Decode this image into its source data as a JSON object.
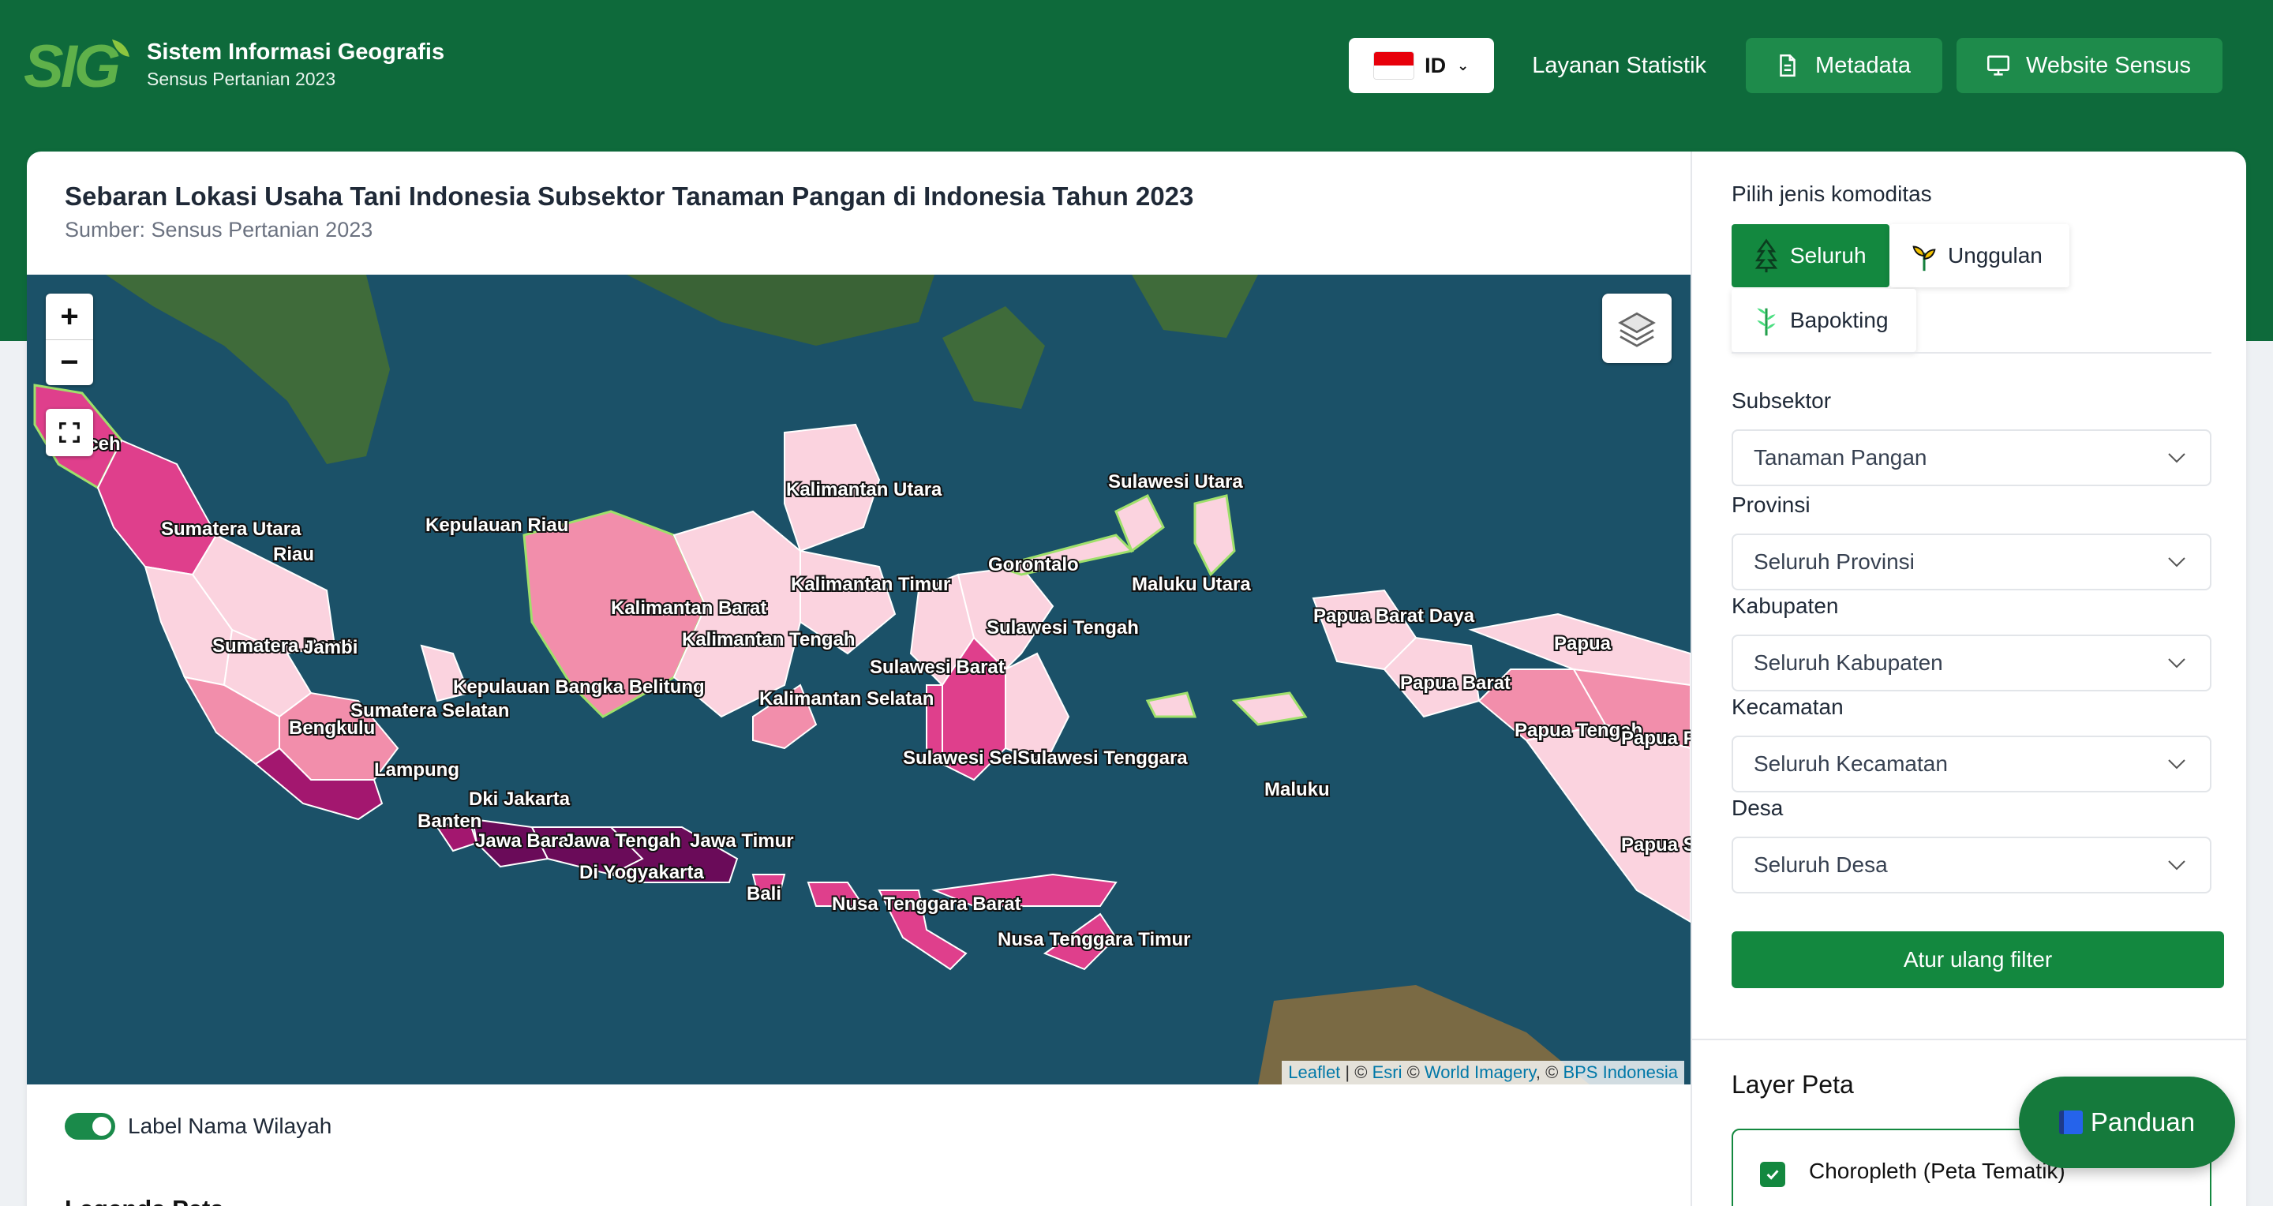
{
  "header": {
    "app_title": "Sistem Informasi Geografis",
    "app_subtitle": "Sensus Pertanian 2023",
    "lang": "ID",
    "nav_link": "Layanan Statistik",
    "btn_metadata": "Metadata",
    "btn_website": "Website Sensus"
  },
  "main": {
    "title": "Sebaran Lokasi Usaha Tani Indonesia Subsektor Tanaman Pangan di Indonesia Tahun 2023",
    "source": "Sumber: Sensus Pertanian 2023"
  },
  "map": {
    "zoom_in": "+",
    "zoom_out": "−",
    "attribution": {
      "leaflet": "Leaflet",
      "sep1": " | © ",
      "esri": "Esri",
      "sep2": " © ",
      "imagery": "World Imagery",
      "sep3": ", © ",
      "bps": "BPS Indonesia"
    },
    "labels": {
      "aceh": "Aceh",
      "sumut": "Sumatera Utara",
      "riau": "Riau",
      "kepri": "Kepulauan Riau",
      "sumbar": "Sumatera Barat",
      "jambi": "Jambi",
      "sumsel": "Sumatera Selatan",
      "babel": "Kepulauan Bangka Belitung",
      "bengkulu": "Bengkulu",
      "lampung": "Lampung",
      "dki": "Dki Jakarta",
      "banten": "Banten",
      "jabar": "Jawa Barat",
      "jateng": "Jawa Tengah",
      "diy": "Di Yogyakarta",
      "jatim": "Jawa Timur",
      "bali": "Bali",
      "ntb": "Nusa Tenggara Barat",
      "ntt": "Nusa Tenggara Timur",
      "kalbar": "Kalimantan Barat",
      "kalteng": "Kalimantan Tengah",
      "kalsel": "Kalimantan Selatan",
      "kaltim": "Kalimantan Timur",
      "kaltara": "Kalimantan Utara",
      "sulbar": "Sulawesi Barat",
      "sulsel": "Sulawesi Selatan",
      "sulteng": "Sulawesi Tengah",
      "sultra": "Sulawesi Tenggara",
      "gorontalo": "Gorontalo",
      "sulut": "Sulawesi Utara",
      "malut": "Maluku Utara",
      "maluku": "Maluku",
      "pbd": "Papua Barat Daya",
      "pb": "Papua Barat",
      "papua": "Papua",
      "pt": "Papua Tengah",
      "pp": "Papua Pegunungan",
      "ps": "Papua Selatan"
    },
    "colors": {
      "sea": "#1b5168",
      "land": "#3f6b3a",
      "lightest": "#fbd3df",
      "light": "#f28eab",
      "mid": "#df3f8c",
      "dark": "#a3176f",
      "darkest": "#6a0b59"
    }
  },
  "footer_left": {
    "toggle_label": "Label Nama Wilayah",
    "legend_title": "Legenda Peta"
  },
  "panel": {
    "commodity_label": "Pilih jenis komoditas",
    "seg_all": "Seluruh",
    "seg_unggulan": "Unggulan",
    "seg_bapokting": "Bapokting",
    "subsektor_label": "Subsektor",
    "subsektor_value": "Tanaman Pangan",
    "provinsi_label": "Provinsi",
    "provinsi_value": "Seluruh Provinsi",
    "kabupaten_label": "Kabupaten",
    "kabupaten_value": "Seluruh Kabupaten",
    "kecamatan_label": "Kecamatan",
    "kecamatan_value": "Seluruh Kecamatan",
    "desa_label": "Desa",
    "desa_value": "Seluruh Desa",
    "reset": "Atur ulang filter",
    "layer_title": "Layer Peta",
    "layer_name": "Choropleth (Peta Tematik)"
  },
  "panduan": "Panduan"
}
